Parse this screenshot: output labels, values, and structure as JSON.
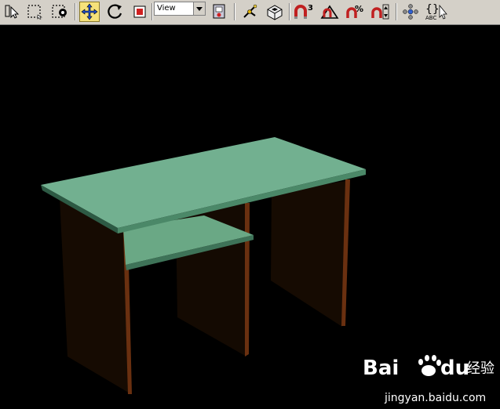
{
  "toolbar": {
    "view_dropdown": {
      "selected": "View"
    },
    "buttons": [
      {
        "name": "select-object-icon"
      },
      {
        "name": "rectangular-selection-icon"
      },
      {
        "name": "window-crossing-icon"
      },
      {
        "name": "select-and-move-icon",
        "active": true
      },
      {
        "name": "select-and-rotate-icon"
      },
      {
        "name": "select-and-scale-icon"
      },
      {
        "name": "use-pivot-center-icon"
      },
      {
        "name": "select-and-manipulate-icon"
      },
      {
        "name": "keyboard-shortcut-override-icon"
      },
      {
        "name": "snaps-toggle-icon",
        "label": "3"
      },
      {
        "name": "angle-snap-icon"
      },
      {
        "name": "percent-snap-icon",
        "label": "%"
      },
      {
        "name": "spinner-snap-icon"
      },
      {
        "name": "named-selection-sets-icon"
      },
      {
        "name": "mirror-text-icon",
        "label": "ABC"
      }
    ],
    "colors": {
      "active_bg": "#f6e27a",
      "bg": "#d4d0c8"
    }
  },
  "viewport": {
    "background": "#000000",
    "object": "desk",
    "colors": {
      "top": "#6fae8c",
      "legs": "#1a0d02",
      "edge": "#5c2a10"
    }
  },
  "watermark": {
    "brand_a": "Bai",
    "brand_b": "du",
    "cn": "经验",
    "url": "jingyan.baidu.com"
  }
}
